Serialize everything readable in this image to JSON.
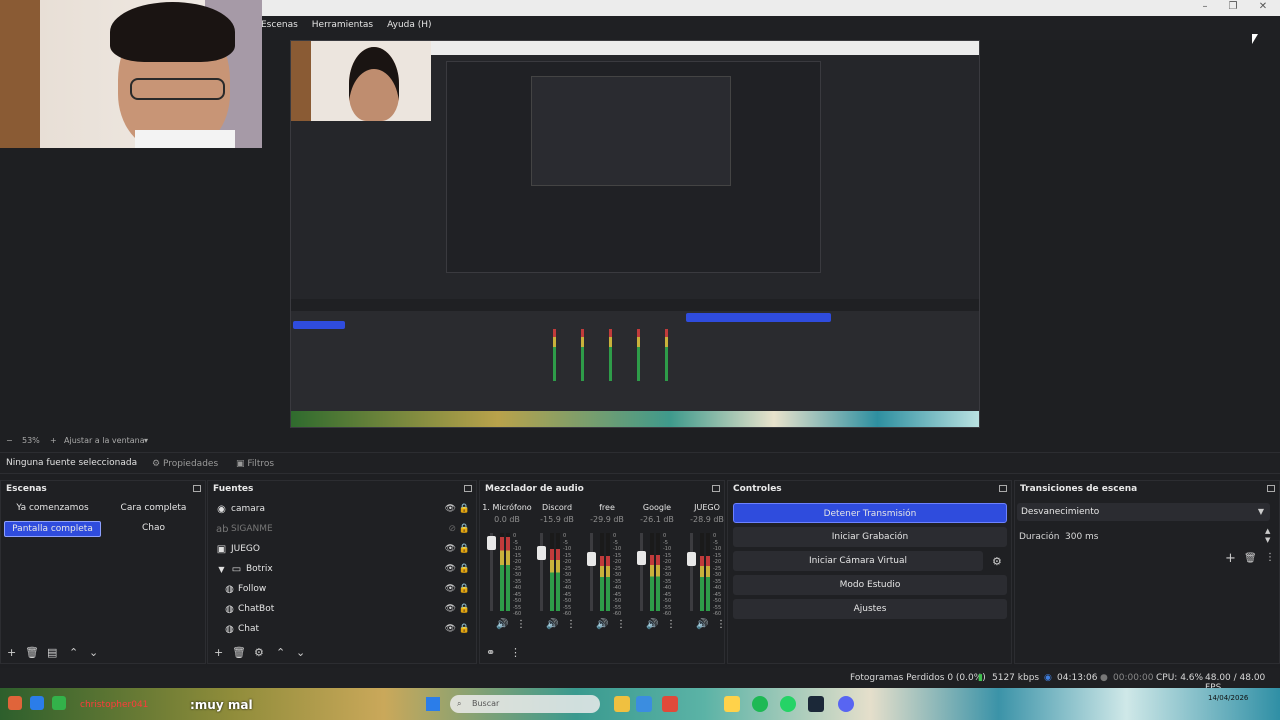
{
  "menu": [
    "Escenas",
    "Herramientas",
    "Ayuda (H)"
  ],
  "zoom": {
    "percent": "53%",
    "fit_label": "Ajustar a la ventana"
  },
  "source_toolbar": {
    "no_selection": "Ninguna fuente seleccionada",
    "properties": "Propiedades",
    "filters": "Filtros"
  },
  "scenes": {
    "title": "Escenas",
    "items": [
      {
        "label": "Ya comenzamos",
        "active": false
      },
      {
        "label": "Cara completa",
        "active": false
      },
      {
        "label": "Pantalla completa",
        "active": true
      },
      {
        "label": "Chao",
        "active": false
      }
    ]
  },
  "sources": {
    "title": "Fuentes",
    "items": [
      {
        "label": "camara",
        "icon": "camera-icon",
        "visible": true
      },
      {
        "label": "SIGANME",
        "icon": "text-icon",
        "visible": false
      },
      {
        "label": "JUEGO",
        "icon": "window-capture-icon",
        "visible": true
      },
      {
        "label": "Botrix",
        "icon": "folder-icon",
        "visible": true
      },
      {
        "label": "Follow",
        "icon": "browser-icon",
        "visible": true
      },
      {
        "label": "ChatBot",
        "icon": "browser-icon",
        "visible": true
      },
      {
        "label": "Chat",
        "icon": "browser-icon",
        "visible": true
      }
    ]
  },
  "mixer": {
    "title": "Mezclador de audio",
    "channels": [
      {
        "name": "1. Micrófono",
        "db": "0.0 dB",
        "level": 0.95
      },
      {
        "name": "Discord",
        "db": "-15.9 dB",
        "level": 0.8
      },
      {
        "name": "free",
        "db": "-29.9 dB",
        "level": 0.7
      },
      {
        "name": "Google",
        "db": "-26.1 dB",
        "level": 0.72
      },
      {
        "name": "JUEGO",
        "db": "-28.9 dB",
        "level": 0.7
      }
    ],
    "scale": [
      "0",
      "-5",
      "-10",
      "-15",
      "-20",
      "-25",
      "-30",
      "-35",
      "-40",
      "-45",
      "-50",
      "-55",
      "-60"
    ]
  },
  "controls": {
    "title": "Controles",
    "buttons": [
      "Detener Transmisión",
      "Iniciar Grabación",
      "Iniciar Cámara Virtual",
      "Modo Estudio",
      "Ajustes"
    ]
  },
  "transitions": {
    "title": "Transiciones de escena",
    "selected": "Desvanecimiento",
    "duration_label": "Duración",
    "duration_value": "300 ms"
  },
  "status": {
    "dropped": "Fotogramas Perdidos 0 (0.0%)",
    "bitrate": "5127 kbps",
    "stream_time": "04:13:06",
    "rec_time": "00:00:00",
    "cpu": "CPU: 4.6%",
    "fps": "48.00 / 48.00 FPS"
  },
  "taskbar": {
    "user": "christopher041",
    "message": ":muy mal",
    "search": "Buscar",
    "clock_date": "14/04/2026"
  },
  "colors": {
    "accent": "#2f4cdd",
    "panel": "#1f2023",
    "background": "#1e1f22"
  }
}
